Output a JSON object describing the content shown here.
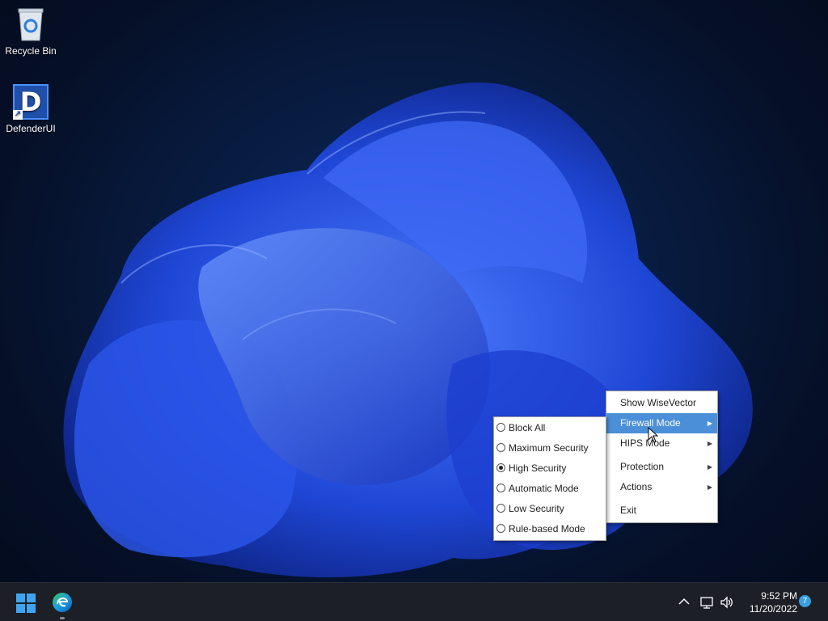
{
  "desktop": {
    "icons": [
      {
        "label": "Recycle Bin",
        "icon": "recycle-bin-icon"
      },
      {
        "label": "DefenderUI",
        "icon": "defenderui-icon",
        "glyph": "D"
      }
    ]
  },
  "context_menu": {
    "items": [
      {
        "label": "Show WiseVector",
        "has_submenu": false
      },
      {
        "label": "Firewall Mode",
        "has_submenu": true,
        "highlighted": true
      },
      {
        "label": "HIPS Mode",
        "has_submenu": true
      },
      {
        "label": "Protection",
        "has_submenu": true
      },
      {
        "label": "Actions",
        "has_submenu": true
      },
      {
        "label": "Exit",
        "has_submenu": false
      }
    ]
  },
  "firewall_submenu": {
    "selected": "High Security",
    "items": [
      {
        "label": "Block All",
        "checked": false
      },
      {
        "label": "Maximum Security",
        "checked": false
      },
      {
        "label": "High Security",
        "checked": true
      },
      {
        "label": "Automatic Mode",
        "checked": false
      },
      {
        "label": "Low Security",
        "checked": false
      },
      {
        "label": "Rule-based Mode",
        "checked": false
      }
    ]
  },
  "taskbar": {
    "time": "9:52 PM",
    "date": "11/20/2022",
    "notification_count": "7",
    "icons": [
      "windows-start-icon",
      "edge-icon",
      "chevron-up-icon",
      "network-icon",
      "volume-icon"
    ]
  },
  "colors": {
    "menu_highlight": "#4a8fd8",
    "taskbar": "#1c1f26",
    "accent": "#3a9ee0"
  }
}
